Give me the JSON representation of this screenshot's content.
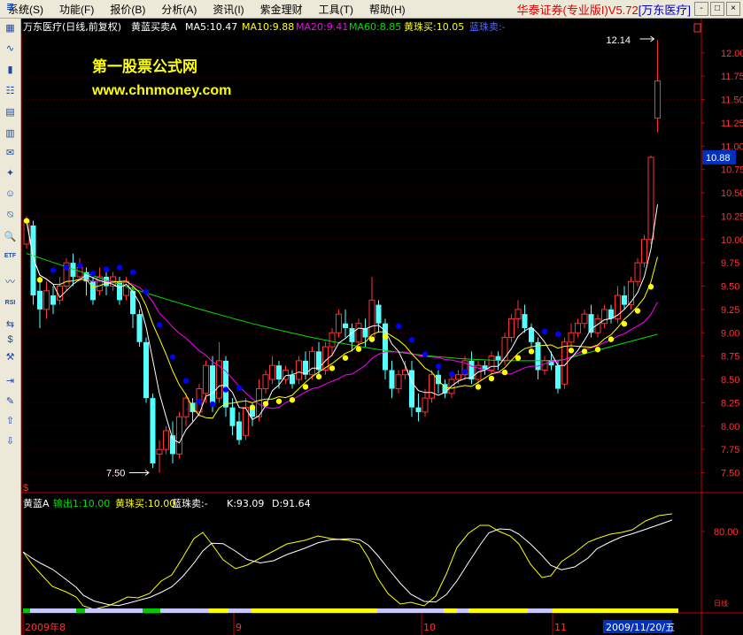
{
  "menu": {
    "items": [
      "系统(S)",
      "功能(F)",
      "报价(B)",
      "分析(A)",
      "资讯(I)",
      "紫金理财",
      "工具(T)",
      "帮助(H)"
    ],
    "brand": "华泰证券(专业版I)V5.72",
    "stock_tag": "[万东医疗]",
    "window_controls": [
      "-",
      "□",
      "×"
    ]
  },
  "toolbar": {
    "icons": [
      "list-icon",
      "table-icon",
      "line-chart-icon",
      "candle-chart-icon",
      "quote-board-icon",
      "grid-icon",
      "detail-icon",
      "news-icon",
      "compass-icon",
      "people-icon",
      "filter-icon",
      "search-icon",
      "etf-icon",
      "wave-icon",
      "rsi-icon",
      "swap-icon",
      "money-icon",
      "tools-icon",
      "export-icon",
      "pencil-icon",
      "up-arrow-icon",
      "down-arrow-icon"
    ],
    "labels": [
      "≣",
      "▦",
      "∿",
      "▮",
      "☷",
      "▤",
      "▥",
      "✉",
      "✦",
      "☺",
      "⍉",
      "🔍",
      "ETF",
      "〰",
      "RSI",
      "⇆",
      "$",
      "⚒",
      "⇥",
      "✎",
      "⇧",
      "⇩"
    ]
  },
  "main_header": {
    "stock": "万东医疗(日线,前复权)",
    "indicator": "黄蓝买卖A",
    "ma5": "MA5:10.47",
    "ma10": "MA10:9.88",
    "ma20": "MA20:9.41",
    "ma60": "MA60:8.85",
    "yellow_buy": "黄珠买:10.05",
    "blue_sell": "蓝珠卖:-"
  },
  "watermark": {
    "line1": "第一股票公式网",
    "line2": "www.chnmoney.com"
  },
  "annotations": {
    "high": "12.14",
    "low": "7.50"
  },
  "current_price": "10.88",
  "sub_header": {
    "name": "黄蓝A",
    "out1": "输出1:10.00",
    "yellow": "黄珠买:10.00",
    "blue": "蓝珠卖:-",
    "k": "K:93.09",
    "d": "D:91.64"
  },
  "sub_axis_label": "80.00",
  "date_labels": {
    "d0": "2009年8",
    "d1": "9",
    "d2": "10",
    "d3": "11",
    "cursor": "2009/11/20/五"
  },
  "corner_mark": "$",
  "small_tag": "日线",
  "colors": {
    "up": "#ff3232",
    "down": "#54ffff",
    "ma5": "#ffffff",
    "ma10": "#ffff00",
    "ma20": "#ff00ff",
    "ma60": "#00e000",
    "yellow_bead": "#ffff00",
    "blue_bead": "#0000ff",
    "axis": "#c00000"
  },
  "chart_data": {
    "type": "candlestick",
    "y_axis": {
      "min": 7.25,
      "max": 12.25,
      "ticks": [
        "7.50",
        "7.75",
        "8.00",
        "8.25",
        "8.50",
        "8.75",
        "9.00",
        "9.25",
        "9.50",
        "9.75",
        "10.00",
        "10.25",
        "10.50",
        "10.75",
        "11.00",
        "11.25",
        "11.50",
        "11.75",
        "12.00"
      ]
    },
    "candles": [
      [
        9.95,
        10.2,
        9.9,
        10.25
      ],
      [
        10.15,
        9.4,
        9.3,
        10.2
      ],
      [
        9.45,
        9.25,
        9.05,
        9.6
      ],
      [
        9.25,
        9.45,
        9.15,
        9.55
      ],
      [
        9.4,
        9.3,
        9.2,
        9.5
      ],
      [
        9.35,
        9.5,
        9.3,
        9.6
      ],
      [
        9.5,
        9.75,
        9.45,
        9.8
      ],
      [
        9.75,
        9.6,
        9.5,
        9.85
      ],
      [
        9.6,
        9.7,
        9.55,
        9.8
      ],
      [
        9.65,
        9.55,
        9.4,
        9.7
      ],
      [
        9.55,
        9.35,
        9.3,
        9.6
      ],
      [
        9.45,
        9.6,
        9.4,
        9.7
      ],
      [
        9.6,
        9.5,
        9.4,
        9.65
      ],
      [
        9.5,
        9.6,
        9.45,
        9.65
      ],
      [
        9.55,
        9.35,
        9.3,
        9.6
      ],
      [
        9.4,
        9.55,
        9.35,
        9.6
      ],
      [
        9.45,
        9.2,
        9.05,
        9.5
      ],
      [
        9.2,
        8.9,
        8.85,
        9.25
      ],
      [
        8.9,
        8.3,
        8.25,
        8.95
      ],
      [
        8.3,
        7.6,
        7.55,
        8.35
      ],
      [
        7.7,
        7.75,
        7.5,
        7.85
      ],
      [
        7.75,
        7.95,
        7.7,
        8.0
      ],
      [
        7.9,
        7.7,
        7.6,
        8.05
      ],
      [
        7.7,
        8.1,
        7.65,
        8.15
      ],
      [
        8.1,
        8.3,
        8.0,
        8.35
      ],
      [
        8.25,
        8.15,
        8.05,
        8.3
      ],
      [
        8.15,
        8.4,
        8.1,
        8.45
      ],
      [
        8.35,
        8.65,
        8.25,
        8.7
      ],
      [
        8.65,
        8.25,
        8.15,
        8.75
      ],
      [
        8.3,
        8.7,
        8.25,
        8.9
      ],
      [
        8.7,
        8.2,
        8.1,
        8.75
      ],
      [
        8.2,
        8.0,
        7.9,
        8.3
      ],
      [
        8.05,
        7.85,
        7.8,
        8.15
      ],
      [
        7.9,
        8.2,
        7.85,
        8.3
      ],
      [
        8.2,
        8.1,
        8.0,
        8.25
      ],
      [
        8.1,
        8.4,
        8.05,
        8.5
      ],
      [
        8.4,
        8.55,
        8.35,
        8.6
      ],
      [
        8.5,
        8.65,
        8.45,
        8.75
      ],
      [
        8.65,
        8.5,
        8.4,
        8.7
      ],
      [
        8.5,
        8.6,
        8.45,
        8.65
      ],
      [
        8.55,
        8.45,
        8.4,
        8.6
      ],
      [
        8.5,
        8.7,
        8.45,
        8.75
      ],
      [
        8.7,
        8.55,
        8.5,
        8.8
      ],
      [
        8.55,
        8.8,
        8.5,
        8.85
      ],
      [
        8.8,
        8.6,
        8.55,
        8.9
      ],
      [
        8.6,
        8.85,
        8.55,
        8.9
      ],
      [
        8.85,
        9.0,
        8.75,
        9.05
      ],
      [
        9.0,
        9.2,
        8.95,
        9.25
      ],
      [
        9.1,
        9.05,
        8.95,
        9.25
      ],
      [
        9.05,
        8.9,
        8.8,
        9.1
      ],
      [
        8.9,
        9.1,
        8.85,
        9.15
      ],
      [
        9.05,
        8.95,
        8.85,
        9.15
      ],
      [
        8.95,
        9.35,
        8.9,
        9.6
      ],
      [
        9.3,
        9.1,
        9.0,
        9.35
      ],
      [
        9.1,
        8.6,
        8.5,
        9.15
      ],
      [
        8.6,
        8.4,
        8.3,
        8.7
      ],
      [
        8.4,
        8.55,
        8.35,
        8.6
      ],
      [
        8.55,
        8.6,
        8.5,
        8.7
      ],
      [
        8.6,
        8.2,
        8.1,
        8.7
      ],
      [
        8.2,
        8.15,
        8.05,
        8.35
      ],
      [
        8.15,
        8.3,
        8.1,
        8.4
      ],
      [
        8.3,
        8.55,
        8.25,
        8.6
      ],
      [
        8.55,
        8.45,
        8.35,
        8.6
      ],
      [
        8.45,
        8.35,
        8.3,
        8.5
      ],
      [
        8.35,
        8.5,
        8.3,
        8.55
      ],
      [
        8.5,
        8.55,
        8.45,
        8.6
      ],
      [
        8.55,
        8.7,
        8.5,
        8.75
      ],
      [
        8.7,
        8.5,
        8.45,
        8.8
      ],
      [
        8.5,
        8.65,
        8.45,
        8.7
      ],
      [
        8.65,
        8.6,
        8.55,
        8.7
      ],
      [
        8.6,
        8.75,
        8.55,
        8.8
      ],
      [
        8.75,
        8.7,
        8.6,
        8.8
      ],
      [
        8.7,
        8.95,
        8.65,
        9.0
      ],
      [
        8.95,
        9.15,
        8.9,
        9.2
      ],
      [
        9.15,
        9.25,
        9.05,
        9.35
      ],
      [
        9.2,
        9.05,
        9.0,
        9.3
      ],
      [
        9.05,
        8.9,
        8.85,
        9.1
      ],
      [
        8.9,
        8.6,
        8.5,
        8.95
      ],
      [
        8.6,
        8.7,
        8.55,
        8.75
      ],
      [
        8.7,
        8.65,
        8.6,
        8.8
      ],
      [
        8.65,
        8.4,
        8.35,
        8.7
      ],
      [
        8.45,
        8.9,
        8.4,
        8.95
      ],
      [
        8.9,
        9.0,
        8.85,
        9.1
      ],
      [
        9.0,
        9.1,
        8.95,
        9.15
      ],
      [
        9.1,
        9.2,
        9.05,
        9.25
      ],
      [
        9.2,
        9.0,
        8.95,
        9.3
      ],
      [
        9.0,
        9.15,
        8.95,
        9.2
      ],
      [
        9.1,
        9.25,
        9.05,
        9.3
      ],
      [
        9.25,
        9.15,
        9.1,
        9.3
      ],
      [
        9.15,
        9.4,
        9.1,
        9.5
      ],
      [
        9.4,
        9.3,
        9.25,
        9.5
      ],
      [
        9.3,
        9.55,
        9.25,
        9.6
      ],
      [
        9.55,
        9.75,
        9.5,
        9.8
      ],
      [
        9.75,
        10.0,
        9.7,
        10.05
      ],
      [
        10.0,
        10.88,
        9.95,
        10.9
      ],
      [
        11.3,
        11.7,
        11.15,
        12.14
      ]
    ],
    "bead_pattern": "blue-then-yellow",
    "kdj": {
      "k_last": 93.09,
      "d_last": 91.64
    }
  }
}
